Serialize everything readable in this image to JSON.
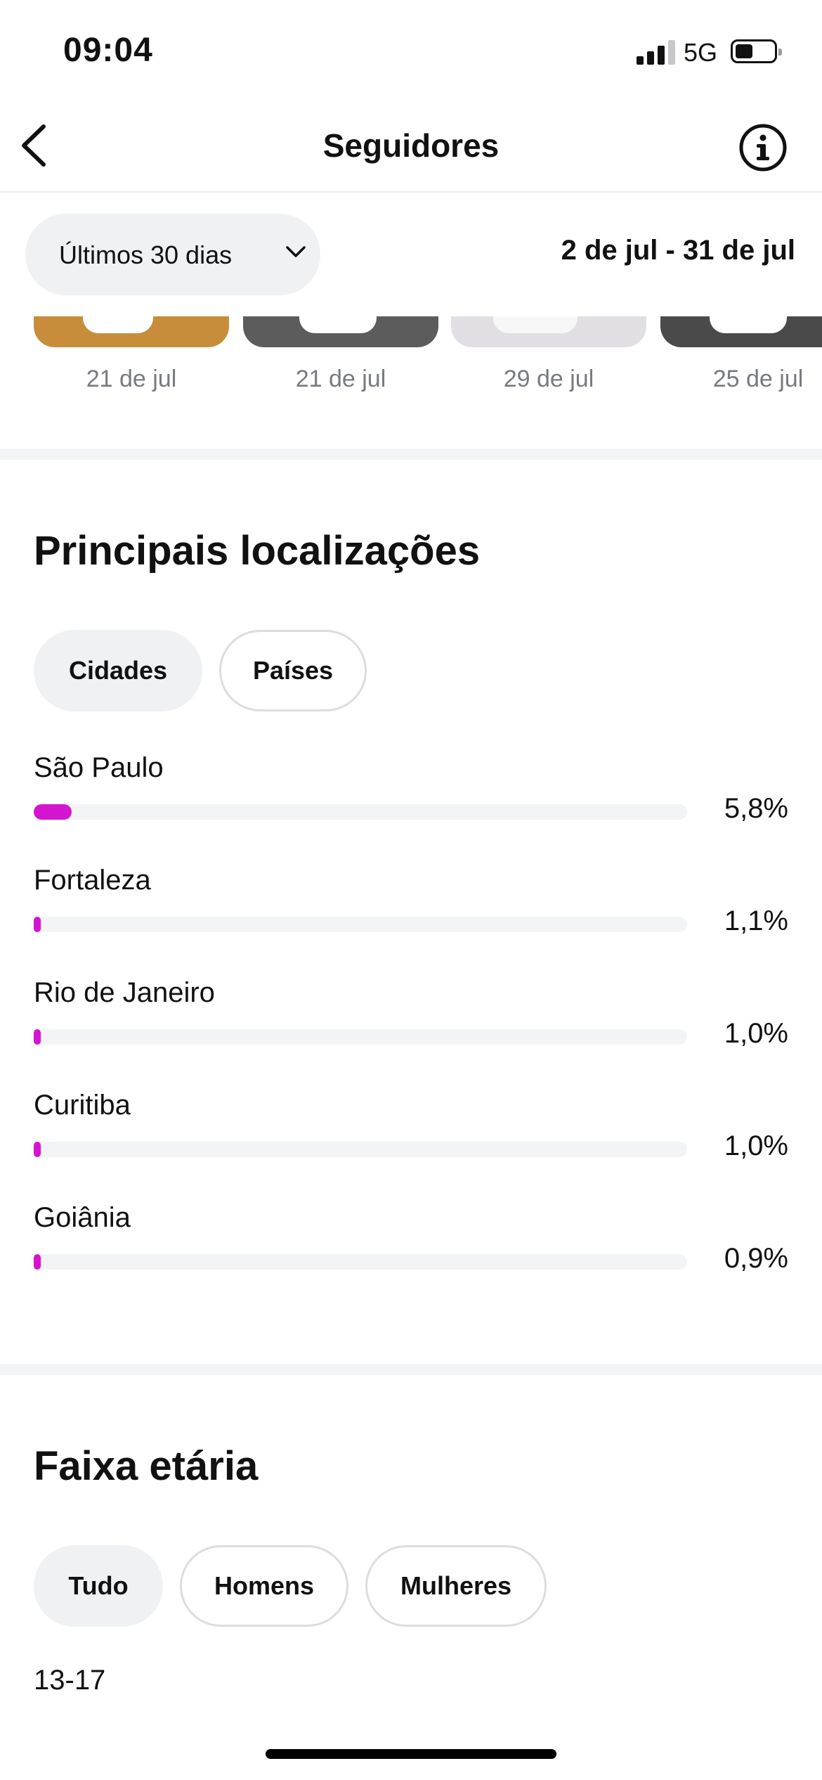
{
  "status_bar": {
    "time": "09:04",
    "network": "5G",
    "battery_level": 0.45
  },
  "nav": {
    "title": "Seguidores",
    "back_icon": "chevron-left-icon",
    "info_icon": "info-icon"
  },
  "filter": {
    "range_label": "Últimos 30 dias",
    "range_icon": "chevron-down-icon",
    "date_range": "2 de jul - 31 de jul"
  },
  "thumbnails": [
    {
      "date": "21 de jul"
    },
    {
      "date": "21 de jul"
    },
    {
      "date": "29 de jul"
    },
    {
      "date": "25 de jul"
    }
  ],
  "locations": {
    "title": "Principais localizações",
    "tabs": [
      {
        "label": "Cidades",
        "active": true
      },
      {
        "label": "Países",
        "active": false
      }
    ],
    "items": [
      {
        "name": "São Paulo",
        "percent": 5.8,
        "percent_label": "5,8%"
      },
      {
        "name": "Fortaleza",
        "percent": 1.1,
        "percent_label": "1,1%"
      },
      {
        "name": "Rio de Janeiro",
        "percent": 1.0,
        "percent_label": "1,0%"
      },
      {
        "name": "Curitiba",
        "percent": 1.0,
        "percent_label": "1,0%"
      },
      {
        "name": "Goiânia",
        "percent": 0.9,
        "percent_label": "0,9%"
      }
    ],
    "bar_color": "#d514cf"
  },
  "age": {
    "title": "Faixa etária",
    "tabs": [
      {
        "label": "Tudo",
        "active": true
      },
      {
        "label": "Homens",
        "active": false
      },
      {
        "label": "Mulheres",
        "active": false
      }
    ],
    "first_bucket": "13-17"
  }
}
